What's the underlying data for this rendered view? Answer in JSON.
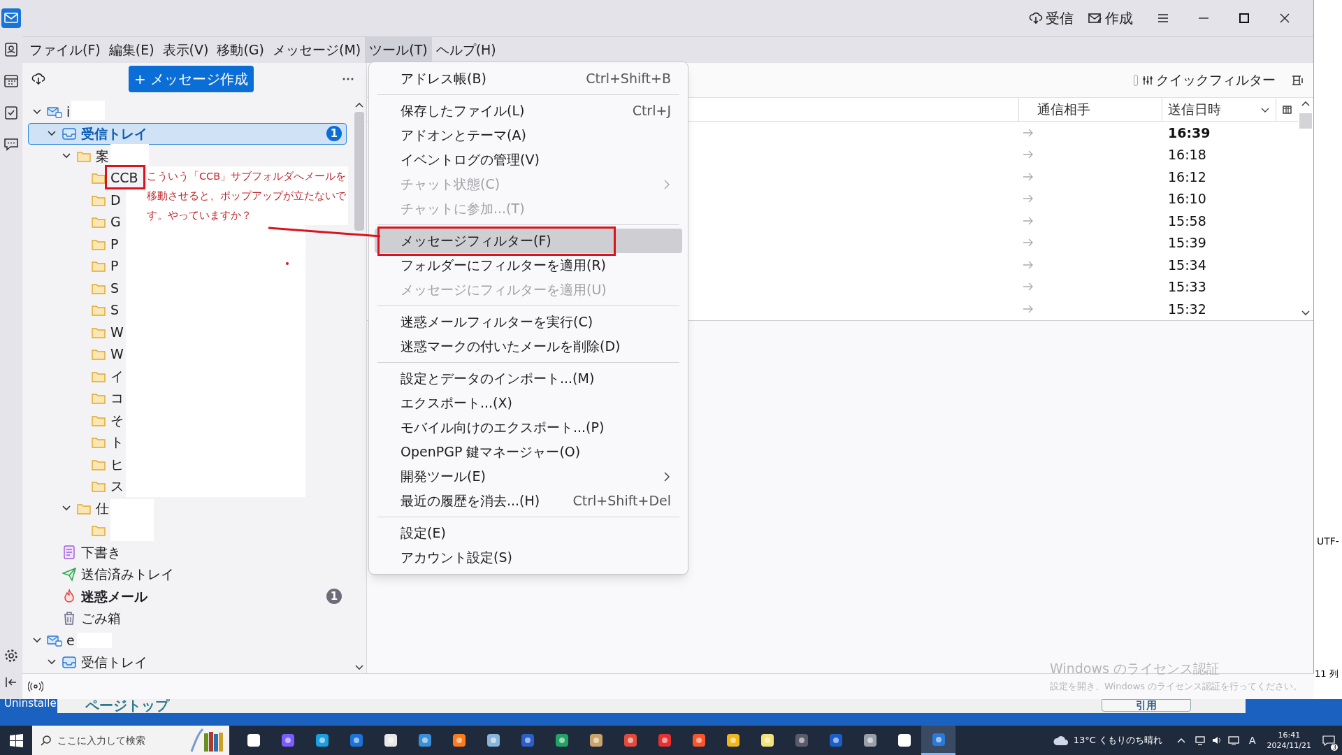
{
  "spaces_bar": [
    {
      "selected": true
    },
    {
      "selected": false
    },
    {
      "selected": false
    },
    {
      "selected": false
    },
    {
      "selected": false
    }
  ],
  "title_bar": {
    "buttons": [
      {
        "label": "受信"
      },
      {
        "label": "作成"
      }
    ]
  },
  "menu_bar": [
    {
      "label": "ファイル(F)",
      "selected": false
    },
    {
      "label": "編集(E)",
      "selected": false
    },
    {
      "label": "表示(V)",
      "selected": false
    },
    {
      "label": "移動(G)",
      "selected": false
    },
    {
      "label": "メッセージ(M)",
      "selected": false
    },
    {
      "label": "ツール(T)",
      "selected": true
    },
    {
      "label": "ヘルプ(H)",
      "selected": false
    }
  ],
  "folder_pane": {
    "compose_button": "+ メッセージ作成",
    "tree": [
      {
        "label": "i",
        "kind": "account",
        "selected": false,
        "unread": false,
        "expanded": true,
        "children": [
          {
            "label": "受信トレイ",
            "kind": "inbox",
            "selected": true,
            "unread": true,
            "badge": "1",
            "expanded": true,
            "children": [
              {
                "label": "案",
                "kind": "folder",
                "selected": false,
                "unread": false,
                "expanded": true,
                "children": [
                  {
                    "label": "CCB",
                    "kind": "folder",
                    "selected": false,
                    "unread": false
                  },
                  {
                    "label": "D",
                    "kind": "folder",
                    "selected": false,
                    "unread": false
                  },
                  {
                    "label": "G",
                    "kind": "folder",
                    "selected": false,
                    "unread": false
                  },
                  {
                    "label": "P",
                    "kind": "folder",
                    "selected": false,
                    "unread": false
                  },
                  {
                    "label": "P",
                    "kind": "folder",
                    "selected": false,
                    "unread": false
                  },
                  {
                    "label": "S",
                    "kind": "folder",
                    "selected": false,
                    "unread": false
                  },
                  {
                    "label": "S",
                    "kind": "folder",
                    "selected": false,
                    "unread": false
                  },
                  {
                    "label": "W",
                    "kind": "folder",
                    "selected": false,
                    "unread": false
                  },
                  {
                    "label": "W",
                    "kind": "folder",
                    "selected": false,
                    "unread": false
                  },
                  {
                    "label": "イ",
                    "kind": "folder",
                    "selected": false,
                    "unread": false
                  },
                  {
                    "label": "コ",
                    "kind": "folder",
                    "selected": false,
                    "unread": false
                  },
                  {
                    "label": "そ",
                    "kind": "folder",
                    "selected": false,
                    "unread": false
                  },
                  {
                    "label": "ト",
                    "kind": "folder",
                    "selected": false,
                    "unread": false
                  },
                  {
                    "label": "ヒ",
                    "kind": "folder",
                    "selected": false,
                    "unread": false
                  },
                  {
                    "label": "ス",
                    "kind": "folder",
                    "selected": false,
                    "unread": false
                  }
                ]
              },
              {
                "label": "仕",
                "kind": "folder",
                "selected": false,
                "unread": false,
                "expanded": true,
                "children": [
                  {
                    "kind": "folder",
                    "selected": false
                  }
                ]
              }
            ]
          },
          {
            "label": "下書き",
            "kind": "drafts",
            "selected": false,
            "unread": false
          },
          {
            "label": "送信済みトレイ",
            "kind": "sent",
            "selected": false,
            "unread": false
          },
          {
            "label": "迷惑メール",
            "kind": "junk",
            "selected": false,
            "unread": true,
            "badge": "1"
          },
          {
            "label": "ごみ箱",
            "kind": "trash",
            "selected": false,
            "unread": false
          }
        ]
      },
      {
        "label": "e",
        "kind": "account",
        "selected": false,
        "unread": false,
        "expanded": true,
        "children": [
          {
            "label": "受信トレイ",
            "kind": "inbox",
            "selected": false,
            "unread": false,
            "expanded": true
          }
        ]
      }
    ]
  },
  "message_list": {
    "quick_filter_toggle": {
      "on": false
    },
    "quick_filter": "クイックフィルター",
    "columns": [
      "通信相手",
      "送信日時"
    ],
    "rows": [
      {
        "time": "16:39",
        "unread": true
      },
      {
        "time": "16:18",
        "unread": false
      },
      {
        "time": "16:12",
        "unread": false
      },
      {
        "time": "16:10",
        "unread": false
      },
      {
        "time": "15:58",
        "unread": false
      },
      {
        "time": "15:39",
        "unread": false
      },
      {
        "time": "15:34",
        "unread": false
      },
      {
        "time": "15:33",
        "unread": false
      },
      {
        "time": "15:32",
        "unread": false
      }
    ]
  },
  "tools_menu": [
    {
      "kind": "item",
      "label": "アドレス帳(B)",
      "shortcut": "Ctrl+Shift+B",
      "disabled": false,
      "selected": false,
      "submenu": false
    },
    {
      "kind": "separator"
    },
    {
      "kind": "item",
      "label": "保存したファイル(L)",
      "shortcut": "Ctrl+J",
      "disabled": false,
      "selected": false,
      "submenu": false
    },
    {
      "kind": "item",
      "label": "アドオンとテーマ(A)",
      "disabled": false,
      "selected": false,
      "submenu": false
    },
    {
      "kind": "item",
      "label": "イベントログの管理(V)",
      "disabled": false,
      "selected": false,
      "submenu": false
    },
    {
      "kind": "item",
      "label": "チャット状態(C)",
      "disabled": true,
      "selected": false,
      "submenu": true
    },
    {
      "kind": "item",
      "label": "チャットに参加...(T)",
      "disabled": true,
      "selected": false,
      "submenu": false
    },
    {
      "kind": "separator"
    },
    {
      "kind": "item",
      "label": "メッセージフィルター(F)",
      "disabled": false,
      "selected": true,
      "submenu": false
    },
    {
      "kind": "item",
      "label": "フォルダーにフィルターを適用(R)",
      "disabled": false,
      "selected": false,
      "submenu": false
    },
    {
      "kind": "item",
      "label": "メッセージにフィルターを適用(U)",
      "disabled": true,
      "selected": false,
      "submenu": false
    },
    {
      "kind": "separator"
    },
    {
      "kind": "item",
      "label": "迷惑メールフィルターを実行(C)",
      "disabled": false,
      "selected": false,
      "submenu": false
    },
    {
      "kind": "item",
      "label": "迷惑マークの付いたメールを削除(D)",
      "disabled": false,
      "selected": false,
      "submenu": false
    },
    {
      "kind": "separator"
    },
    {
      "kind": "item",
      "label": "設定とデータのインポート...(M)",
      "disabled": false,
      "selected": false,
      "submenu": false
    },
    {
      "kind": "item",
      "label": "エクスポート...(X)",
      "disabled": false,
      "selected": false,
      "submenu": false
    },
    {
      "kind": "item",
      "label": "モバイル向けのエクスポート...(P)",
      "disabled": false,
      "selected": false,
      "submenu": false
    },
    {
      "kind": "item",
      "label": "OpenPGP 鍵マネージャー(O)",
      "disabled": false,
      "selected": false,
      "submenu": false
    },
    {
      "kind": "item",
      "label": "開発ツール(E)",
      "disabled": false,
      "selected": false,
      "submenu": true
    },
    {
      "kind": "item",
      "label": "最近の履歴を消去...(H)",
      "shortcut": "Ctrl+Shift+Del",
      "disabled": false,
      "selected": false,
      "submenu": false
    },
    {
      "kind": "separator"
    },
    {
      "kind": "item",
      "label": "設定(E)",
      "disabled": false,
      "selected": false,
      "submenu": false
    },
    {
      "kind": "item",
      "label": "アカウント設定(S)",
      "disabled": false,
      "selected": false,
      "submenu": false
    }
  ],
  "annotation": {
    "text": "こういう「CCB」サブフォルダへメールを移動させると、ポップアップが立たないです。やっていますか？"
  },
  "watermark": {
    "title": "Windows のライセンス認証",
    "text": "設定を開き、Windows のライセンス認証を行ってください。"
  },
  "background_windows": {
    "left_texts": [
      "Uninstalle",
      "ページトップ"
    ],
    "button": "引用",
    "right_texts": [
      "UTF-",
      "11 列"
    ]
  },
  "taskbar": {
    "search_placeholder": "ここに入力して検索",
    "apps": [
      {
        "selected": false
      },
      {
        "selected": false
      },
      {
        "selected": false
      },
      {
        "selected": false
      },
      {
        "selected": false
      },
      {
        "selected": false
      },
      {
        "selected": false
      },
      {
        "selected": false
      },
      {
        "selected": false
      },
      {
        "selected": false
      },
      {
        "selected": false
      },
      {
        "selected": false
      },
      {
        "selected": false
      },
      {
        "selected": false
      },
      {
        "selected": false
      },
      {
        "selected": false
      },
      {
        "selected": false
      },
      {
        "selected": false
      },
      {
        "selected": false
      },
      {
        "selected": false
      },
      {
        "selected": true
      }
    ],
    "weather": "13°C くもりのち晴れ",
    "ime": "A",
    "time": "16:41",
    "date": "2024/11/21",
    "notifications": "3"
  }
}
